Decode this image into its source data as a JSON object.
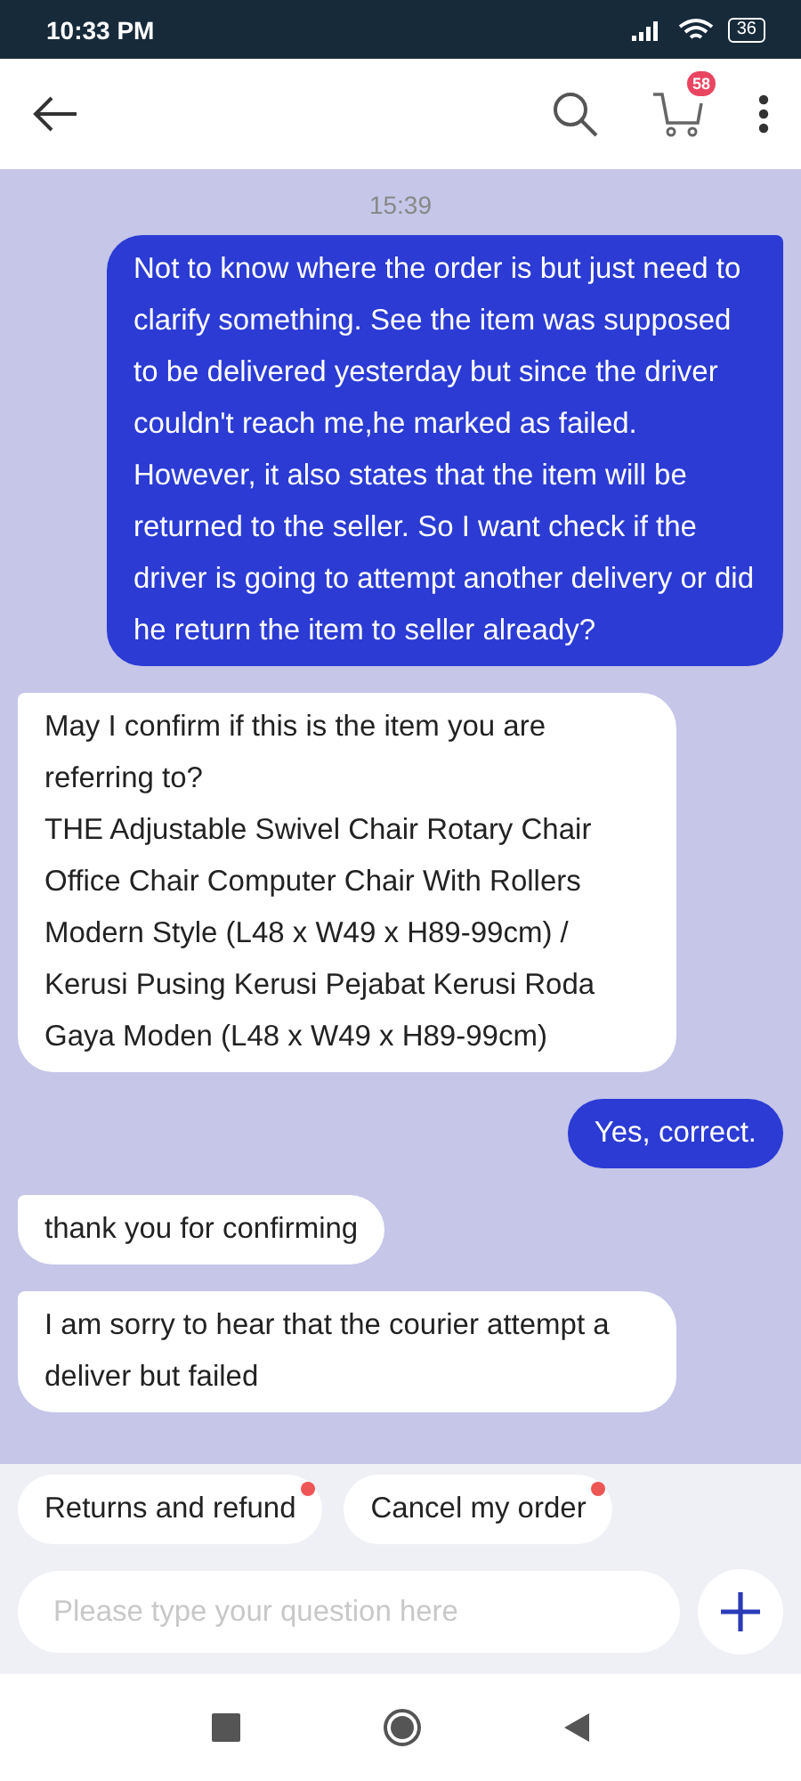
{
  "status_bar": {
    "time": "10:33 PM",
    "battery": "36"
  },
  "header": {
    "cart_count": "58"
  },
  "chat": {
    "timestamp": "15:39",
    "messages": [
      {
        "kind": "sent",
        "text": "Not to know where the order is but just need to clarify something. See the item was supposed to be delivered yesterday but since the driver couldn't reach me,he marked as failed. However, it also states that the item will be returned to the seller. So I want check if the driver is going to attempt another delivery or did he return the item to seller already?"
      },
      {
        "kind": "received",
        "text": "May I confirm if this is the item you are referring to?\nTHE Adjustable Swivel Chair Rotary Chair Office Chair Computer Chair With Rollers Modern Style (L48 x W49 x H89-99cm) / Kerusi Pusing Kerusi Pejabat Kerusi Roda Gaya Moden (L48 x W49 x H89-99cm)"
      },
      {
        "kind": "sent",
        "text": "Yes, correct."
      },
      {
        "kind": "received",
        "text": "thank you for confirming"
      },
      {
        "kind": "received",
        "text": "I am sorry to hear that the courier attempt a deliver but failed"
      }
    ]
  },
  "quick_replies": [
    {
      "label": "Returns and refund",
      "new": true
    },
    {
      "label": "Cancel my order",
      "new": true
    }
  ],
  "composer": {
    "placeholder": "Please type your question here"
  }
}
